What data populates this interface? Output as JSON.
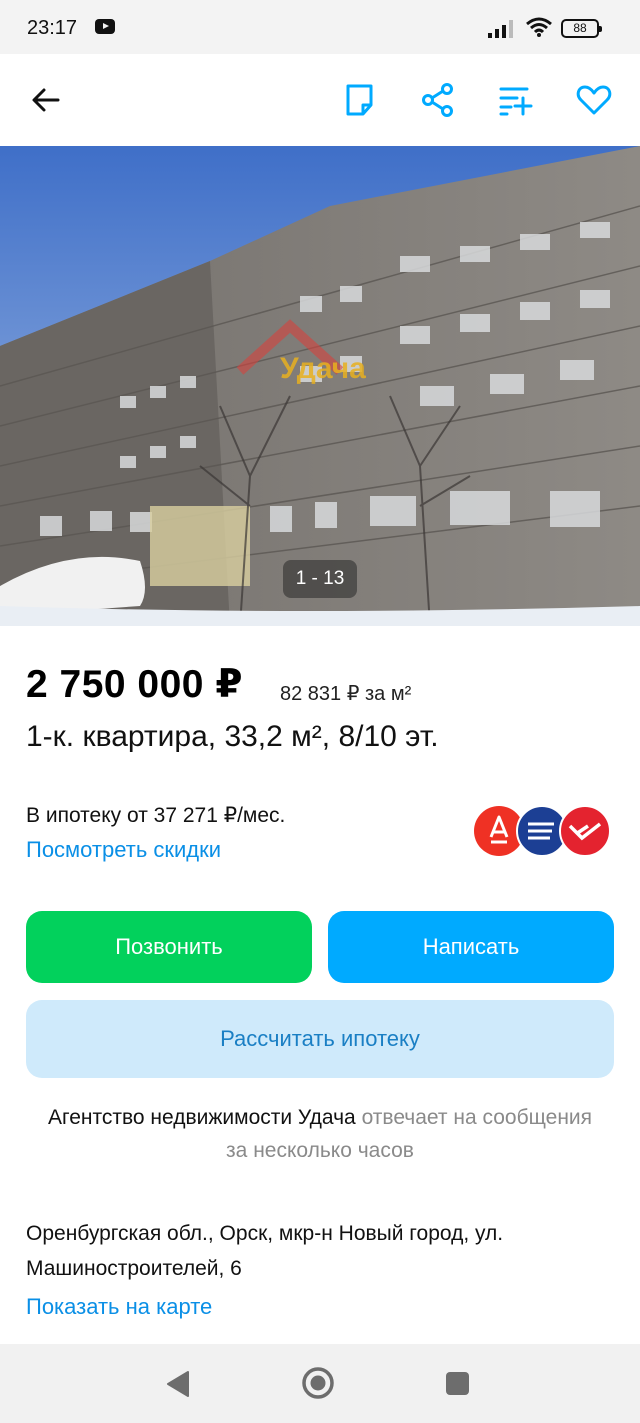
{
  "status_bar": {
    "time": "23:17",
    "battery": "88"
  },
  "toolbar": {
    "icons": [
      "back-arrow-icon",
      "note-icon",
      "share-icon",
      "compare-list-icon",
      "heart-icon"
    ],
    "accent_color": "#00aaff"
  },
  "photo": {
    "watermark": "Удача",
    "counter": "1 - 13"
  },
  "listing": {
    "price": "2 750 000 ₽",
    "price_per_m": "82 831 ₽ за м²",
    "title": "1-к. квартира, 33,2 м², 8/10 эт."
  },
  "mortgage": {
    "text": "В ипотеку от 37 271 ₽/мес.",
    "discount_link": "Посмотреть скидки",
    "bank_icons": [
      "alfa-bank-logo",
      "gazprombank-logo",
      "psb-logo"
    ]
  },
  "actions": {
    "call": "Позвонить",
    "write": "Написать",
    "calc_mortgage": "Рассчитать ипотеку",
    "call_color": "#02d15c",
    "write_color": "#00aaff"
  },
  "agency": {
    "name": "Агентство недвижимости Удача",
    "response_text": " отвечает на сообщения за несколько часов"
  },
  "address": {
    "text": "Оренбургская обл., Орск, мкр-н Новый город, ул. Машиностроителей, 6",
    "map_link": "Показать на карте"
  }
}
